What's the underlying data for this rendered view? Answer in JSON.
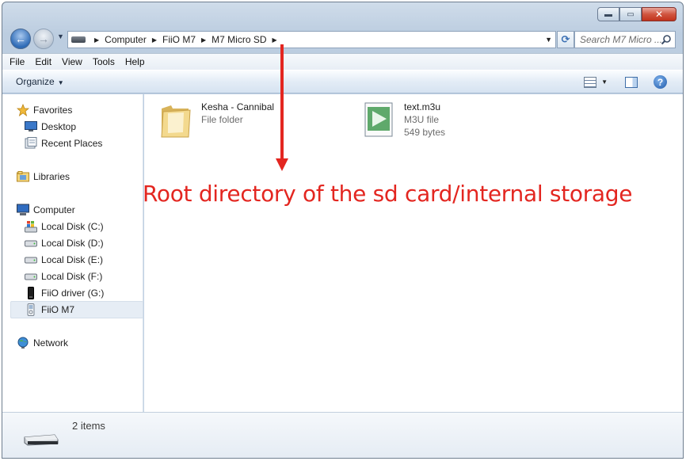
{
  "window": {
    "minimize_glyph": "▬",
    "maximize_glyph": "▭",
    "close_glyph": "✕"
  },
  "nav": {
    "back_glyph": "←",
    "forward_glyph": "→",
    "address": {
      "crumbs": [
        "Computer",
        "FiiO M7",
        "M7 Micro SD"
      ]
    },
    "refresh_glyph": "⟳",
    "search_placeholder": "Search M7 Micro ..."
  },
  "menu": [
    "File",
    "Edit",
    "View",
    "Tools",
    "Help"
  ],
  "commandbar": {
    "organize_label": "Organize",
    "help_glyph": "?"
  },
  "sidebar": {
    "favorites": {
      "label": "Favorites",
      "icon": "star-icon"
    },
    "favorites_items": [
      {
        "label": "Desktop",
        "icon": "desktop-icon"
      },
      {
        "label": "Recent Places",
        "icon": "recent-places-icon"
      }
    ],
    "libraries": {
      "label": "Libraries",
      "icon": "libraries-icon"
    },
    "computer": {
      "label": "Computer",
      "icon": "computer-icon"
    },
    "computer_items": [
      {
        "label": "Local Disk (C:)",
        "icon": "windows-drive-icon"
      },
      {
        "label": "Local Disk (D:)",
        "icon": "drive-icon"
      },
      {
        "label": "Local Disk (E:)",
        "icon": "drive-icon"
      },
      {
        "label": "Local Disk (F:)",
        "icon": "drive-icon"
      },
      {
        "label": "FiiO driver (G:)",
        "icon": "usb-drive-icon"
      },
      {
        "label": "FiiO M7",
        "icon": "device-icon",
        "selected": true
      }
    ],
    "network": {
      "label": "Network",
      "icon": "network-icon"
    }
  },
  "files": [
    {
      "name": "Kesha - Cannibal",
      "type": "File folder",
      "size": "",
      "icon": "folder-icon"
    },
    {
      "name": "text.m3u",
      "type": "M3U file",
      "size": "549 bytes",
      "icon": "media-file-icon"
    }
  ],
  "annotation": "Root directory of the sd card/internal storage",
  "details": {
    "count": "2 items"
  },
  "colors": {
    "annotation": "#e32620",
    "selection": "#e6edf5",
    "chrome": "#c7d6e6"
  }
}
